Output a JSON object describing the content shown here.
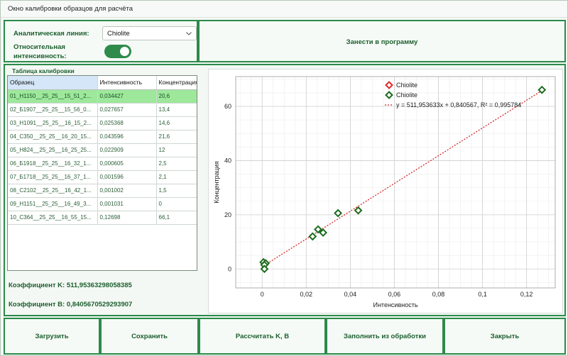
{
  "window": {
    "title": "Окно калибровки образцов для расчёта"
  },
  "config": {
    "line_label": "Аналитическая линия:",
    "line_value": "Chiolite",
    "relative_label_1": "Относительная",
    "relative_label_2": "интенсивность:",
    "relative_enabled": true
  },
  "export_button": "Занести в программу",
  "calibration": {
    "caption": "Таблица калибровки",
    "columns": [
      "Образец",
      "Интенсивность",
      "Концентрация"
    ],
    "rows": [
      [
        "01_Н1150__25_25__15_51_2...",
        "0,034427",
        "20,6"
      ],
      [
        "02_Б1907__25_25__15_56_0...",
        "0,027657",
        "13,4"
      ],
      [
        "03_Н1091__25_25__16_15_2...",
        "0,025368",
        "14,6"
      ],
      [
        "04_С350__25_25__16_20_15...",
        "0,043596",
        "21,6"
      ],
      [
        "05_Н824__25_25__16_25_25...",
        "0,022909",
        "12"
      ],
      [
        "06_Б1918__25_25__16_32_1...",
        "0,000605",
        "2,5"
      ],
      [
        "07_Б1718__25_25__16_37_1...",
        "0,001596",
        "2,1"
      ],
      [
        "08_С2102__25_25__16_42_1...",
        "0,001002",
        "1,5"
      ],
      [
        "09_Н1151__25_25__16_49_3...",
        "0,001031",
        "0"
      ],
      [
        "10_С364__25_25__16_55_15...",
        "0,12698",
        "66,1"
      ]
    ],
    "coef_k": "Коэффициент K: 511,95363298058385",
    "coef_b": "Коэффициент B: 0,8405670529293907"
  },
  "chart_data": {
    "type": "scatter",
    "xlabel": "Интенсивность",
    "ylabel": "Концентрация",
    "xlim": [
      -0.012,
      0.133
    ],
    "ylim": [
      -7,
      71
    ],
    "xticks": [
      0,
      0.02,
      0.04,
      0.06,
      0.08,
      0.1,
      0.12
    ],
    "xtick_labels": [
      "0",
      "0,02",
      "0,04",
      "0,06",
      "0,08",
      "0,1",
      "0,12"
    ],
    "yticks": [
      0,
      20,
      40,
      60
    ],
    "ytick_labels": [
      "0",
      "20",
      "40",
      "60"
    ],
    "grid": true,
    "legend_position": "top-right",
    "series": [
      {
        "name": "Chiolite",
        "color": "#e52b2b",
        "marker": "diamond",
        "x": [],
        "y": []
      },
      {
        "name": "Chiolite",
        "color": "#1e6b1e",
        "marker": "diamond",
        "x": [
          0.034427,
          0.027657,
          0.025368,
          0.043596,
          0.022909,
          0.000605,
          0.001596,
          0.001002,
          0.001031,
          0.12698
        ],
        "y": [
          20.6,
          13.4,
          14.6,
          21.6,
          12,
          2.5,
          2.1,
          1.5,
          0,
          66.1
        ]
      }
    ],
    "trendline": {
      "label": "y = 511,953633x + 0,840567, R² = 0,995784",
      "color": "#d42a2a",
      "slope": 511.953633,
      "intercept": 0.840567,
      "x_range": [
        0,
        0.12698
      ]
    }
  },
  "buttons": {
    "load": "Загрузить",
    "save": "Сохранить",
    "calc": "Рассчитать K, B",
    "fill": "Заполнить из обработки",
    "close": "Закрыть"
  },
  "colors": {
    "accent": "#2d8a4a",
    "label": "#1c5e2e",
    "selected_row": "#9de89b"
  }
}
